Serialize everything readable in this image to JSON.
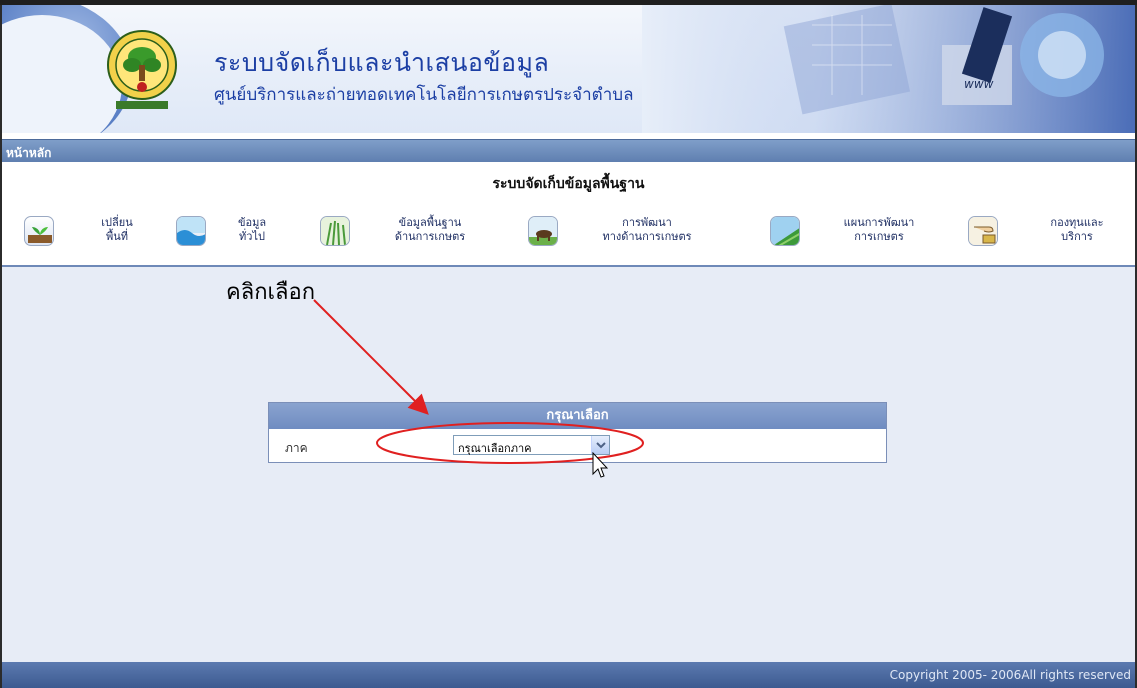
{
  "header": {
    "title": "ระบบจัดเก็บและนำเสนอข้อมูล",
    "subtitle": "ศูนย์บริการและถ่ายทอดเทคโนโลยีการเกษตรประจำตำบล",
    "art_text": "www"
  },
  "home_bar": {
    "label": "หน้าหลัก"
  },
  "section": {
    "title": "ระบบจัดเก็บข้อมูลพื้นฐาน"
  },
  "nav": {
    "items": [
      {
        "label": "เปลี่ยน\nพื้นที่",
        "icon": "seedling-icon"
      },
      {
        "label": "ข้อมูล\nทั่วไป",
        "icon": "water-icon"
      },
      {
        "label": "ข้อมูลพื้นฐาน\nด้านการเกษตร",
        "icon": "rice-plant-icon"
      },
      {
        "label": "การพัฒนา\nทางด้านการเกษตร",
        "icon": "buffalo-icon"
      },
      {
        "label": "แผนการพัฒนา\nการเกษตร",
        "icon": "field-icon"
      },
      {
        "label": "กองทุนและ\nบริการ",
        "icon": "money-hand-icon"
      }
    ]
  },
  "annotation": {
    "text": "คลิกเลือก",
    "color": "#e02020"
  },
  "panel": {
    "title": "กรุณาเลือก",
    "field_label": "ภาค",
    "select_value": "กรุณาเลือกภาค"
  },
  "footer": {
    "copyright": "Copyright 2005- 2006All rights reserved"
  },
  "colors": {
    "accent": "#1c3fa4",
    "bar": "#5f7fb0",
    "content_bg": "#e7ecf6"
  }
}
